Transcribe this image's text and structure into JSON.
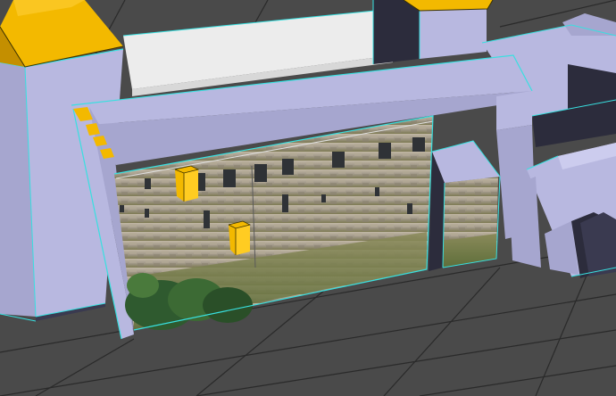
{
  "viewport": {
    "corner_label": ""
  },
  "colors": {
    "background": "#4a4a4a",
    "grid_line": "#2a2a2a",
    "wall_light": "#b8b8e0",
    "wall_mid": "#a6a6cf",
    "wall_dark": "#2c2c3c",
    "roof_yellow": "#f3b900",
    "roof_yellow_dark": "#c48f00",
    "edge_highlight": "#38e0e0",
    "white_roof": "#f0f0f0",
    "texture_stone": "#9c9484",
    "texture_grass": "#6f7a45",
    "tree_green": "#2f5a2f"
  },
  "scene": {
    "objects": [
      "tower-left-with-yellow-roof",
      "tower-right-dark-with-yellow-roof",
      "main-roof-slab",
      "textured-facade-wall",
      "yellow-window-box-upper",
      "yellow-window-box-lower",
      "right-annex-block",
      "right-far-building",
      "buttress-with-steps"
    ]
  }
}
